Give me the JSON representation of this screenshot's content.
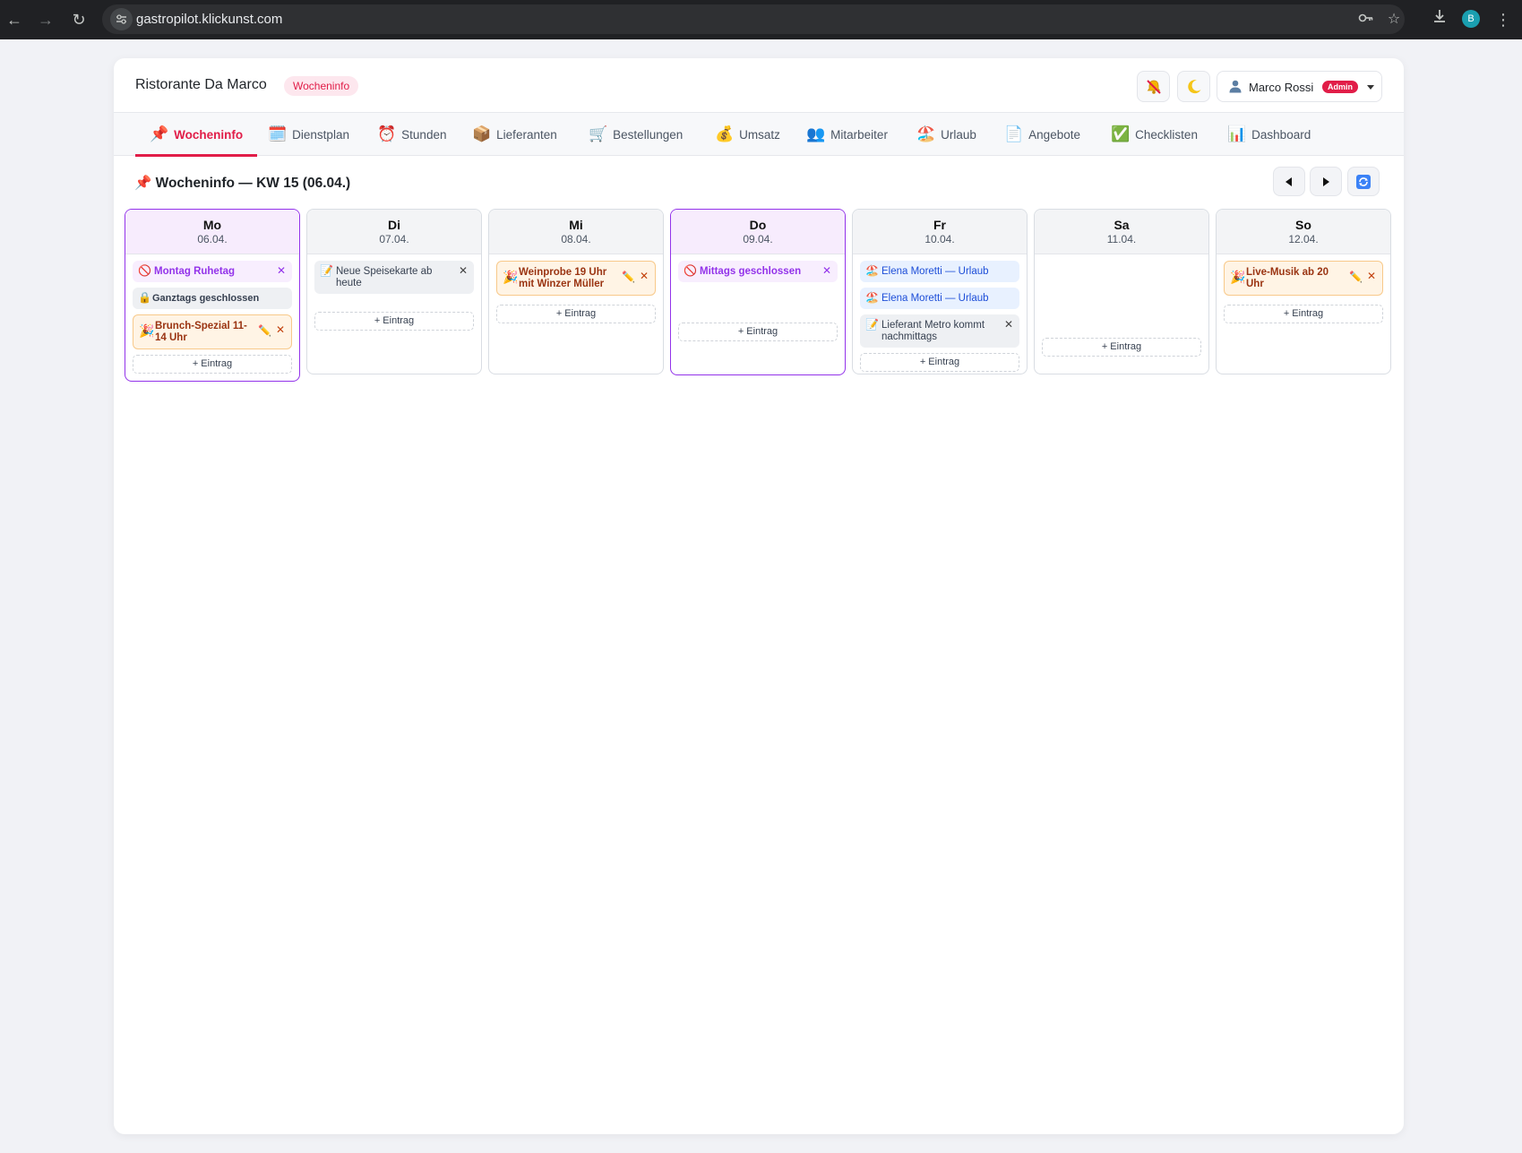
{
  "browser": {
    "url": "gastropilot.klickunst.com",
    "profile_initial": "B"
  },
  "app": {
    "restaurant_name": "Ristorante Da Marco",
    "page_badge": "Wocheninfo",
    "user": {
      "name": "Marco Rossi",
      "role": "Admin"
    },
    "accent_color": "#e11d48"
  },
  "tabs": [
    {
      "icon": "📌",
      "label": "Wocheninfo",
      "active": true
    },
    {
      "icon": "🗓️",
      "label": "Dienstplan"
    },
    {
      "icon": "⏰",
      "label": "Stunden"
    },
    {
      "icon": "📦",
      "label": "Lieferanten"
    },
    {
      "icon": "🛒",
      "label": "Bestellungen"
    },
    {
      "icon": "💰",
      "label": "Umsatz"
    },
    {
      "icon": "👥",
      "label": "Mitarbeiter"
    },
    {
      "icon": "🏖️",
      "label": "Urlaub"
    },
    {
      "icon": "📄",
      "label": "Angebote"
    },
    {
      "icon": "✅",
      "label": "Checklisten"
    },
    {
      "icon": "📊",
      "label": "Dashboard"
    }
  ],
  "week": {
    "title": "📌 Wocheninfo — KW 15 (06.04.)",
    "add_label": "+ Eintrag",
    "days": [
      {
        "name": "Mo",
        "date": "06.04.",
        "highlighted": true,
        "entries": [
          {
            "type": "closed",
            "icon": "🚫",
            "text": "Montag Ruhetag",
            "delete": "✕"
          },
          {
            "type": "allday",
            "icon": "🔒",
            "text": "Ganztags geschlossen"
          },
          {
            "type": "event",
            "icon": "🎉",
            "text": "Brunch-Spezial 11-14 Uhr",
            "edit": "✏️",
            "delete": "✕"
          }
        ]
      },
      {
        "name": "Di",
        "date": "07.04.",
        "entries": [
          {
            "type": "note",
            "icon": "📝",
            "text": "Neue Speisekarte ab heute",
            "delete": "✕"
          }
        ]
      },
      {
        "name": "Mi",
        "date": "08.04.",
        "entries": [
          {
            "type": "event",
            "icon": "🎉",
            "text": "Weinprobe 19 Uhr mit Winzer Müller",
            "edit": "✏️",
            "delete": "✕"
          }
        ]
      },
      {
        "name": "Do",
        "date": "09.04.",
        "highlighted": true,
        "entries": [
          {
            "type": "closed",
            "icon": "🚫",
            "text": "Mittags geschlossen",
            "delete": "✕"
          }
        ]
      },
      {
        "name": "Fr",
        "date": "10.04.",
        "entries": [
          {
            "type": "vac",
            "icon": "🏖️",
            "text": "Elena Moretti — Urlaub"
          },
          {
            "type": "vac",
            "icon": "🏖️",
            "text": "Elena Moretti — Urlaub"
          },
          {
            "type": "note",
            "icon": "📝",
            "text": "Lieferant Metro kommt nachmittags",
            "delete": "✕"
          }
        ]
      },
      {
        "name": "Sa",
        "date": "11.04.",
        "entries": []
      },
      {
        "name": "So",
        "date": "12.04.",
        "entries": [
          {
            "type": "event",
            "icon": "🎉",
            "text": "Live-Musik ab 20 Uhr",
            "edit": "✏️",
            "delete": "✕"
          }
        ]
      }
    ]
  }
}
